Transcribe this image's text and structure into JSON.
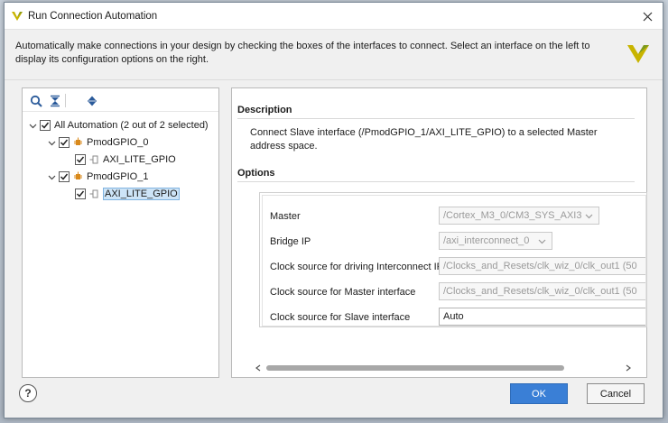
{
  "window": {
    "title": "Run Connection Automation",
    "intro": "Automatically make connections in your design by checking the boxes of the interfaces to connect. Select an interface on the left to display its configuration options on the right."
  },
  "colors": {
    "accent": "#3a7fd6",
    "selection": "#cde4f7",
    "brand": "#c8b400"
  },
  "tree": {
    "toolbar": [
      "search-icon",
      "collapse-all-icon",
      "expand-all-icon"
    ],
    "items": [
      {
        "label": "All Automation (2 out of 2 selected)",
        "checked": true,
        "expanded": true
      },
      {
        "label": "PmodGPIO_0",
        "checked": true,
        "expanded": true
      },
      {
        "label": "AXI_LITE_GPIO",
        "checked": true
      },
      {
        "label": "PmodGPIO_1",
        "checked": true,
        "expanded": true
      },
      {
        "label": "AXI_LITE_GPIO",
        "checked": true,
        "selected": true
      }
    ]
  },
  "details": {
    "description_heading": "Description",
    "description": "Connect Slave interface (/PmodGPIO_1/AXI_LITE_GPIO) to a selected Master address space.",
    "options_heading": "Options",
    "options": [
      {
        "label": "Master",
        "value": "/Cortex_M3_0/CM3_SYS_AXI3",
        "enabled": false,
        "dropdown": true
      },
      {
        "label": "Bridge IP",
        "value": "/axi_interconnect_0",
        "enabled": false,
        "dropdown": true
      },
      {
        "label": "Clock source for driving Interconnect IP",
        "value": "/Clocks_and_Resets/clk_wiz_0/clk_out1 (50",
        "enabled": false,
        "dropdown": false
      },
      {
        "label": "Clock source for Master interface",
        "value": "/Clocks_and_Resets/clk_wiz_0/clk_out1 (50",
        "enabled": false,
        "dropdown": false
      },
      {
        "label": "Clock source for Slave interface",
        "value": "Auto",
        "enabled": true,
        "dropdown": false
      }
    ]
  },
  "buttons": {
    "help": "?",
    "ok": "OK",
    "cancel": "Cancel"
  }
}
